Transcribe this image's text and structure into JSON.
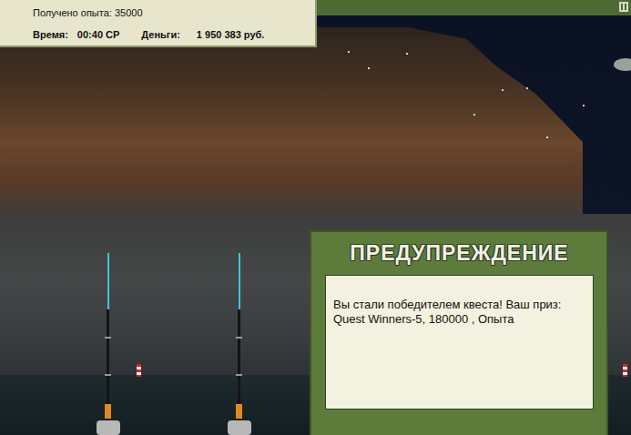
{
  "stats": {
    "experience": "Получено опыта: 35000",
    "time_label": "Время:",
    "time": "00:40 СР",
    "money_label": "Деньги:",
    "money": "1 950 383 руб."
  },
  "dialog": {
    "title": "ПРЕДУПРЕЖДЕНИЕ",
    "message": "Вы стали победителем квеста! Ваш приз: Quest Winners-5, 180000 , Опыта"
  }
}
